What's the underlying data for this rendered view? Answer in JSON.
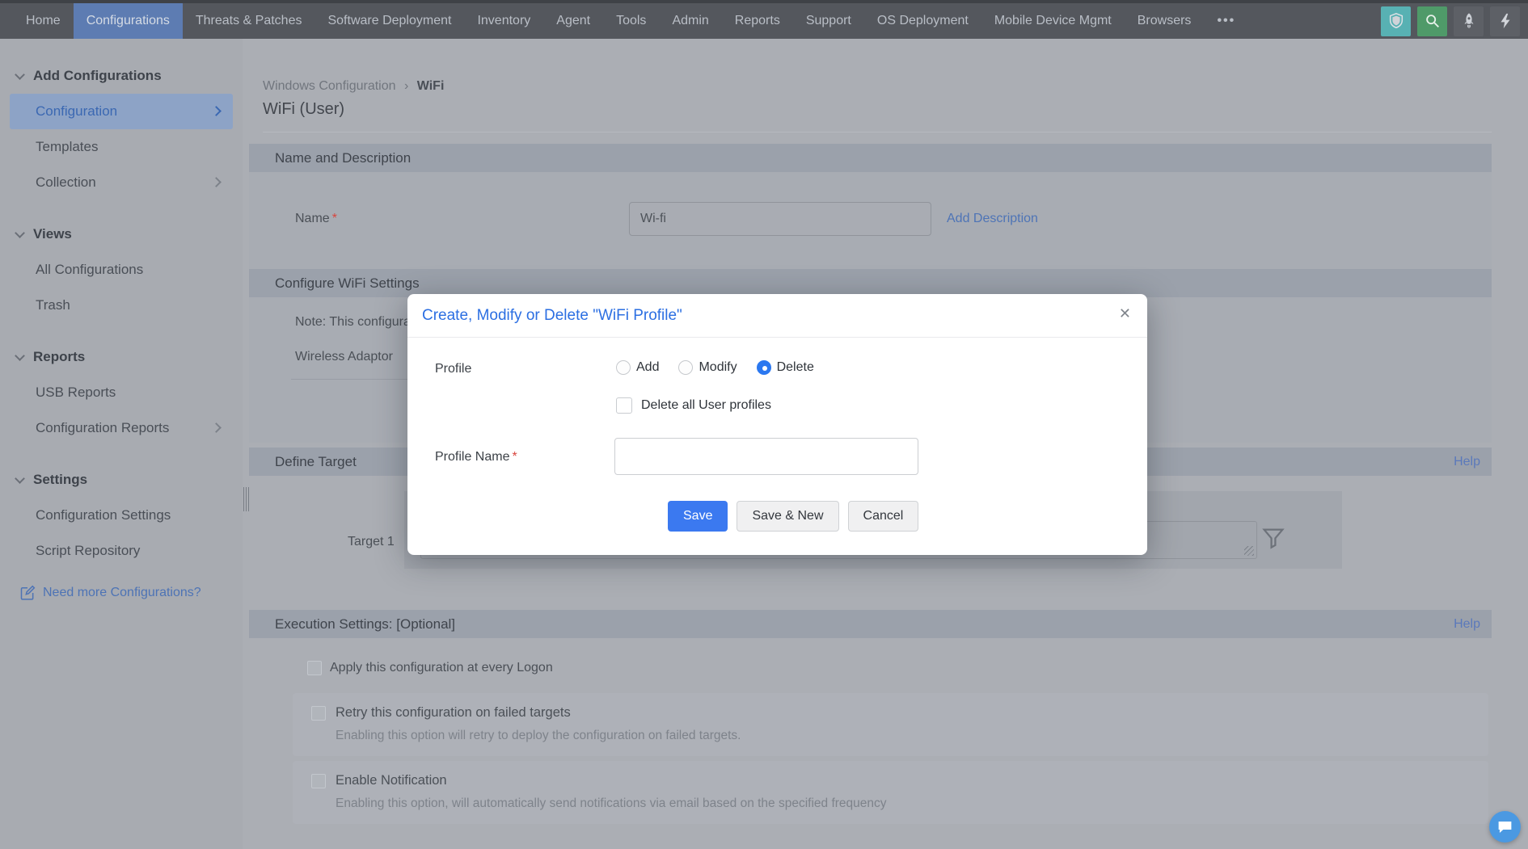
{
  "nav": {
    "items": [
      {
        "label": "Home"
      },
      {
        "label": "Configurations",
        "active": true
      },
      {
        "label": "Threats & Patches"
      },
      {
        "label": "Software Deployment"
      },
      {
        "label": "Inventory"
      },
      {
        "label": "Agent"
      },
      {
        "label": "Tools"
      },
      {
        "label": "Admin"
      },
      {
        "label": "Reports"
      },
      {
        "label": "Support"
      },
      {
        "label": "OS Deployment"
      },
      {
        "label": "Mobile Device Mgmt"
      },
      {
        "label": "Browsers"
      },
      {
        "label": "•••"
      }
    ],
    "icon_colors": {
      "shield_bg": "#58b1b3",
      "search_bg": "#4f9a69",
      "rocket_bg": "#5d6066",
      "lightning_bg": "#5d6066"
    }
  },
  "sidebar": {
    "sections": [
      {
        "label": "Add Configurations",
        "items": [
          {
            "label": "Configuration",
            "selected": true,
            "has_chevron": true
          },
          {
            "label": "Templates"
          },
          {
            "label": "Collection",
            "has_chevron": true
          }
        ]
      },
      {
        "label": "Views",
        "items": [
          {
            "label": "All Configurations"
          },
          {
            "label": "Trash"
          }
        ]
      },
      {
        "label": "Reports",
        "items": [
          {
            "label": "USB Reports"
          },
          {
            "label": "Configuration Reports",
            "has_chevron": true
          }
        ]
      },
      {
        "label": "Settings",
        "items": [
          {
            "label": "Configuration Settings"
          },
          {
            "label": "Script Repository"
          }
        ]
      }
    ],
    "footer_link": "Need more Configurations?"
  },
  "main": {
    "breadcrumb": {
      "part1": "Windows Configuration",
      "separator": "›",
      "part2": "WiFi"
    },
    "title": "WiFi (User)",
    "required_marker": "*",
    "name_section": {
      "header": "Name and Description",
      "name_label": "Name",
      "name_value": "Wi-fi",
      "add_description": "Add Description"
    },
    "wifi_section": {
      "header": "Configure WiFi Settings",
      "note_visible": "Note: This configura",
      "adaptor_label": "Wireless Adaptor"
    },
    "target_section": {
      "header": "Define Target",
      "help": "Help",
      "target_label": "Target 1"
    },
    "execution_section": {
      "header": "Execution Settings: [Optional]",
      "help": "Help",
      "logon_checkbox": "Apply this configuration at every Logon",
      "retry_checkbox": "Retry this configuration on failed targets",
      "retry_sub": "Enabling this option will retry to deploy the configuration on failed targets.",
      "notify_checkbox": "Enable Notification",
      "notify_sub": "Enabling this option, will automatically send notifications via email based on the specified frequency"
    }
  },
  "modal": {
    "title": "Create, Modify or Delete \"WiFi Profile\"",
    "close_glyph": "✕",
    "profile_label": "Profile",
    "radios": [
      {
        "label": "Add",
        "selected": false
      },
      {
        "label": "Modify",
        "selected": false
      },
      {
        "label": "Delete",
        "selected": true
      }
    ],
    "delete_all_checkbox": "Delete all User profiles",
    "profile_name_label": "Profile Name",
    "profile_name_value": "",
    "buttons": {
      "save": "Save",
      "save_new": "Save & New",
      "cancel": "Cancel"
    }
  },
  "colors": {
    "nav_bg": "#54575d",
    "nav_active": "#5d7cb2",
    "modal_title_blue": "#2c6fe2",
    "save_button_blue": "#3b79f0",
    "radio_selected_blue": "#2b78f0",
    "link_blue": "#4e74b6",
    "sidebar_selected_bg": "#8da3c6",
    "required_red": "#d8453e",
    "chat_fab_blue": "#4b99e2"
  }
}
